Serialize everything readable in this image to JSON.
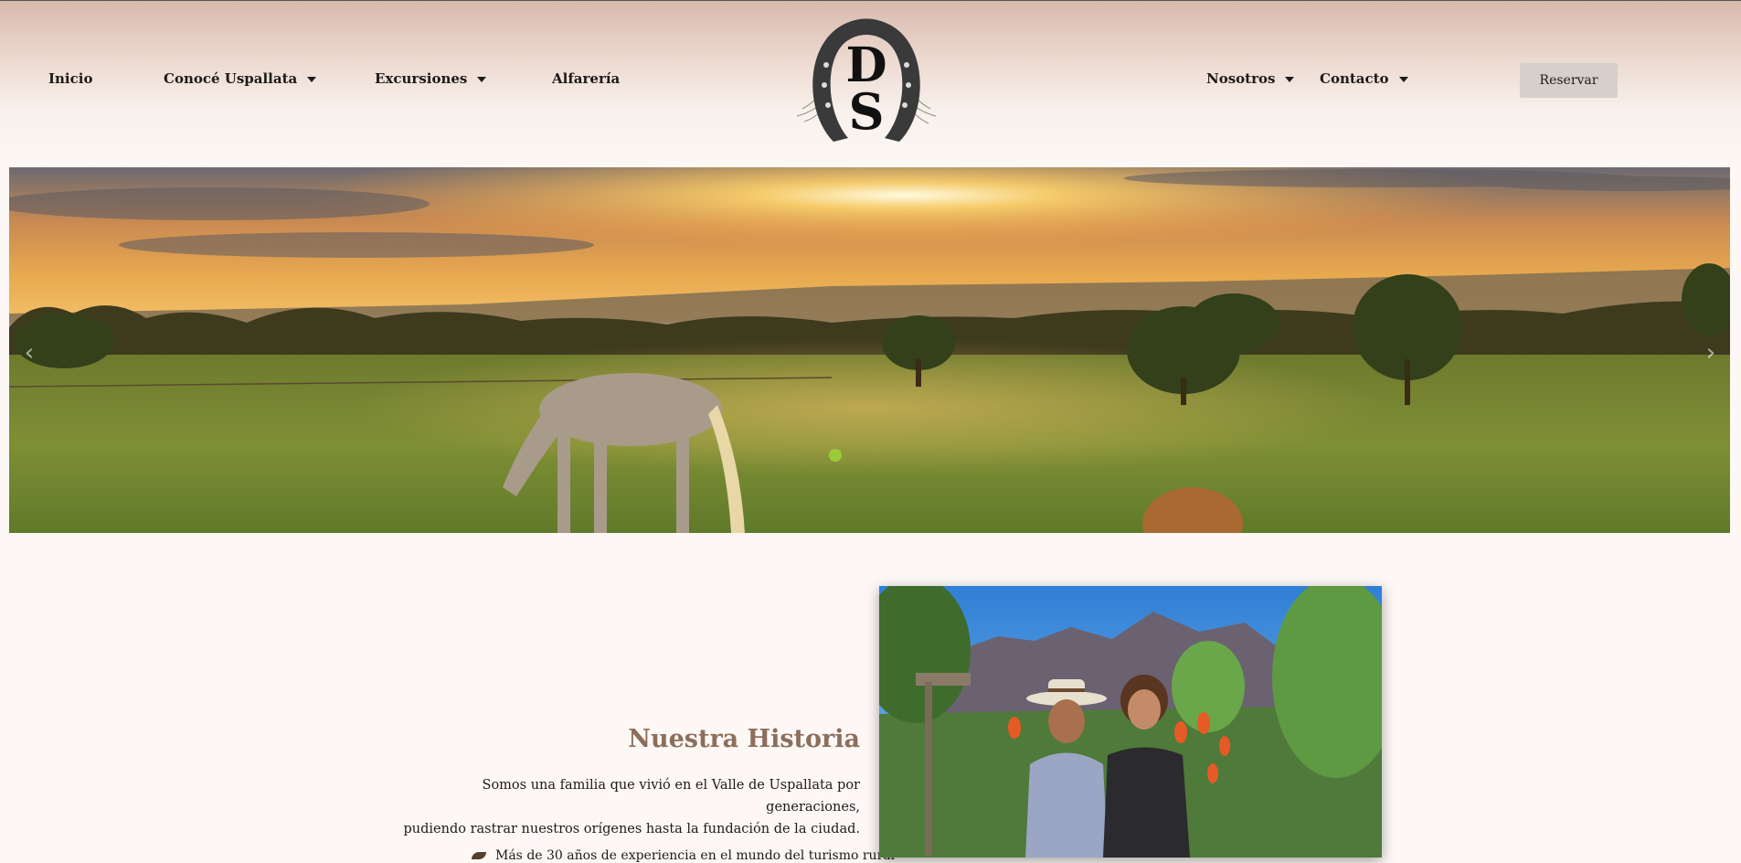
{
  "nav": {
    "left": [
      {
        "label": "Inicio",
        "dropdown": false
      },
      {
        "label": "Conocé Uspallata",
        "dropdown": true
      },
      {
        "label": "Excursiones",
        "dropdown": true
      },
      {
        "label": "Alfarería",
        "dropdown": false
      }
    ],
    "right": [
      {
        "label": "Nosotros",
        "dropdown": true
      },
      {
        "label": "Contacto",
        "dropdown": true
      }
    ],
    "reserve_label": "Reservar",
    "logo_letters": "DS"
  },
  "hero": {
    "image": "sunset-horses-pasture",
    "prev_icon": "chevron-left-icon",
    "next_icon": "chevron-right-icon"
  },
  "story": {
    "title": "Nuestra Historia",
    "paragraph_line1": "Somos una familia que vivió en el Valle de Uspallata por generaciones,",
    "paragraph_line2": "pudiendo rastrar nuestros orígenes hasta la fundación de la ciudad.",
    "teaser": "Más de 30 años de experiencia en el mundo del turismo rural"
  },
  "colors": {
    "accent": "#8c6e5d",
    "button_bg": "#d6d0cb",
    "page_bg": "#fdf8f5"
  }
}
